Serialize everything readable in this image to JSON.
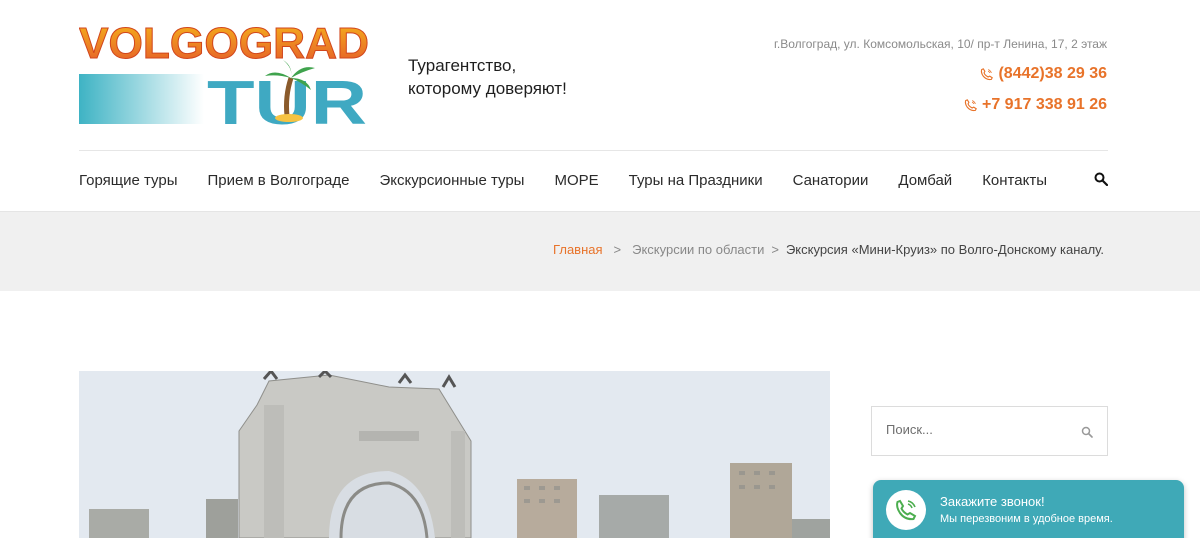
{
  "header": {
    "logo_top": "VOLGOGRAD",
    "logo_bottom": "TUR",
    "tagline_line1": "Турагентство,",
    "tagline_line2": "которому доверяют!",
    "address": "г.Волгоград, ул. Комсомольская, 10/ пр-т Ленина, 17, 2 этаж",
    "phone1": "(8442)38 29 36",
    "phone2": "+7 917 338 91 26",
    "accent_color": "#e8732a"
  },
  "nav": {
    "items": [
      {
        "label": "Горящие туры"
      },
      {
        "label": "Прием в Волгограде"
      },
      {
        "label": "Экскурсионные туры"
      },
      {
        "label": "МОРЕ"
      },
      {
        "label": "Туры на Праздники"
      },
      {
        "label": "Санатории"
      },
      {
        "label": "Домбай"
      },
      {
        "label": "Контакты"
      }
    ],
    "search_icon": "search-icon"
  },
  "breadcrumb": {
    "home": "Главная",
    "separator": ">",
    "parent": "Экскурсии по области",
    "parent_sep": ">",
    "current": "Экскурсия «Мини-Круиз» по Волго-Донскому каналу."
  },
  "sidebar": {
    "search_placeholder": "Поиск..."
  },
  "callback": {
    "title": "Закажите звонок!",
    "subtitle": "Мы перезвоним в удобное время.",
    "color": "#3fa9b7"
  }
}
